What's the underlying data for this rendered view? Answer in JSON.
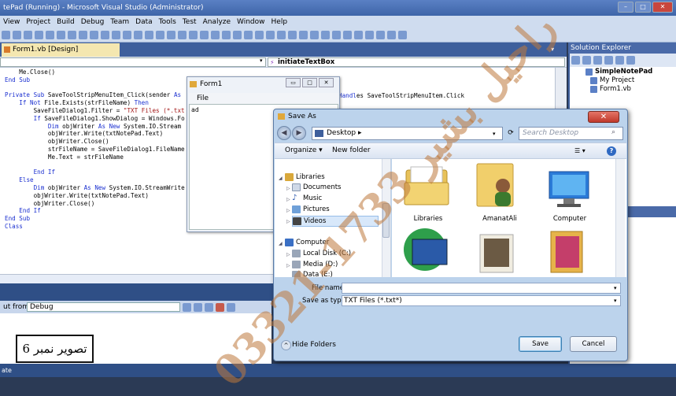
{
  "vs": {
    "title": "tePad (Running) - Microsoft Visual Studio (Administrator)",
    "menu": [
      "View",
      "Project",
      "Build",
      "Debug",
      "Team",
      "Data",
      "Tools",
      "Test",
      "Analyze",
      "Window",
      "Help"
    ],
    "controls": {
      "minimize": "–",
      "maximize": "□",
      "close": "✕"
    }
  },
  "editor": {
    "tab_label": "Form1.vb [Design]",
    "method_combo": "initiateTextBox",
    "code_lines": [
      "    Me.Close()",
      "End Sub",
      "",
      "Private Sub SaveToolStripMenuItem_Click(sender As",
      "    If Not File.Exists(strFileName) Then",
      "        SaveFileDialog1.Filter = \"TXT Files (*.txt",
      "        If SaveFileDialog1.ShowDialog = Windows.Fo",
      "            Dim objWriter As New System.IO.Stream",
      "            objWriter.Write(txtNotePad.Text)",
      "            objWriter.Close()",
      "            strFileName = SaveFileDialog1.FileName",
      "            Me.Text = strFileName",
      "",
      "        End If",
      "    Else",
      "        Dim objWriter As New System.IO.StreamWrite",
      "        objWriter.Write(txtNotePad.Text)",
      "        objWriter.Close()",
      "    End If",
      "End Sub",
      "Class"
    ],
    "handles_fragment": "es SaveToolStripMenuItem.Click"
  },
  "output": {
    "label": "ut from:",
    "selected": "Debug"
  },
  "status_text": "ate",
  "solution_explorer": {
    "title": "Solution Explorer",
    "items": [
      "SimpleNotePad",
      "My Project",
      "Form1.vb"
    ]
  },
  "form1": {
    "title": "Form1",
    "menu_file": "File",
    "text_content": "ad"
  },
  "save_as": {
    "title": "Save As",
    "address": "Desktop",
    "search_placeholder": "Search Desktop",
    "organize": "Organize ▾",
    "new_folder": "New folder",
    "tree": [
      {
        "label": "Libraries",
        "level": 0
      },
      {
        "label": "Documents",
        "level": 1
      },
      {
        "label": "Music",
        "level": 1
      },
      {
        "label": "Pictures",
        "level": 1
      },
      {
        "label": "Videos",
        "level": 1
      },
      {
        "label": "Computer",
        "level": 0
      },
      {
        "label": "Local Disk (C:)",
        "level": 1
      },
      {
        "label": "Media (D:)",
        "level": 1
      },
      {
        "label": "Data (E:)",
        "level": 1
      }
    ],
    "files": [
      "Libraries",
      "AmanatAli",
      "Computer"
    ],
    "file_name_label": "File name:",
    "file_name_value": "",
    "save_type_label": "Save as type:",
    "save_type_value": "TXT Files (*.txt*)",
    "hide_folders": "Hide Folders",
    "save_button": "Save",
    "cancel_button": "Cancel"
  },
  "caption": "تصویر نمبر 6",
  "watermark": "03321-1733 راحيل بشير",
  "colors": {
    "vs_blue": "#3e5f9c",
    "keyword": "#1a2fd0",
    "string": "#a31515",
    "dialog_bg": "#bcd3ec"
  }
}
